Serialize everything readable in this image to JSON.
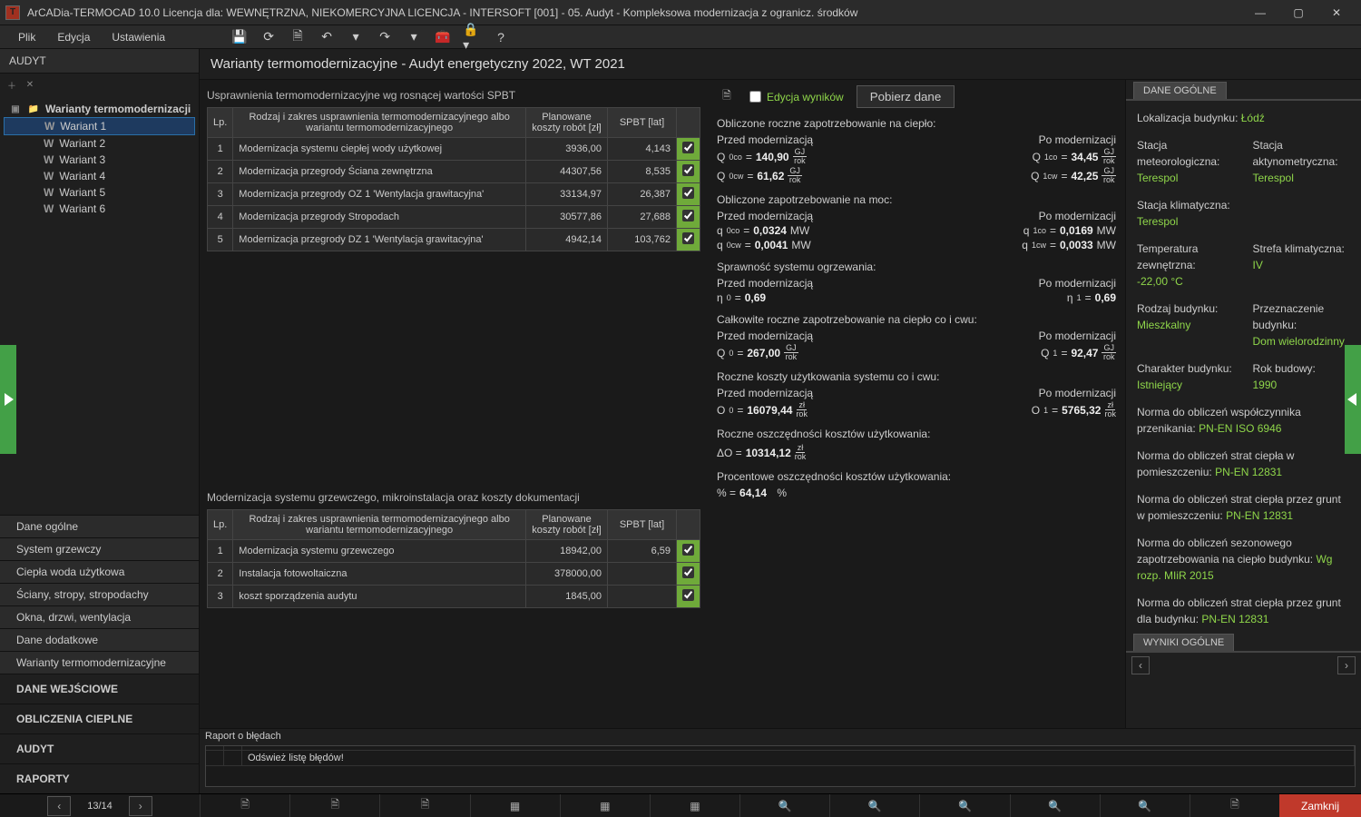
{
  "title": "ArCADia-TERMOCAD 10.0 Licencja dla: WEWNĘTRZNA, NIEKOMERCYJNA LICENCJA - INTERSOFT [001] - 05. Audyt - Kompleksowa modernizacja z ogranicz. środków",
  "menu": {
    "file": "Plik",
    "edit": "Edycja",
    "settings": "Ustawienia"
  },
  "audit_header": "AUDYT",
  "tree_root": "Warianty termomodernizacji",
  "tree_items": [
    "Wariant 1",
    "Wariant 2",
    "Wariant 3",
    "Wariant 4",
    "Wariant 5",
    "Wariant 6"
  ],
  "nav_items": [
    "Dane ogólne",
    "System grzewczy",
    "Ciepła woda użytkowa",
    "Ściany, stropy, stropodachy",
    "Okna, drzwi, wentylacja",
    "Dane dodatkowe",
    "Warianty termomodernizacyjne"
  ],
  "nav_sections": [
    "DANE WEJŚCIOWE",
    "OBLICZENIA CIEPLNE",
    "AUDYT",
    "RAPORTY"
  ],
  "page_title": "Warianty termomodernizacyjne - Audyt energetyczny 2022, WT 2021",
  "table1": {
    "caption": "Usprawnienia termomodernizacyjne wg rosnącej wartości SPBT",
    "headers": [
      "Lp.",
      "Rodzaj i zakres usprawnienia termomodernizacyjnego albo wariantu termomodernizacyjnego",
      "Planowane koszty robót [zł]",
      "SPBT [lat]",
      ""
    ],
    "rows": [
      {
        "lp": "1",
        "desc": "Modernizacja systemu ciepłej wody użytkowej",
        "cost": "3936,00",
        "spbt": "4,143",
        "chk": true
      },
      {
        "lp": "2",
        "desc": "Modernizacja przegrody Ściana zewnętrzna",
        "cost": "44307,56",
        "spbt": "8,535",
        "chk": true
      },
      {
        "lp": "3",
        "desc": "Modernizacja przegrody OZ 1 'Wentylacja grawitacyjna'",
        "cost": "33134,97",
        "spbt": "26,387",
        "chk": true
      },
      {
        "lp": "4",
        "desc": "Modernizacja przegrody Stropodach",
        "cost": "30577,86",
        "spbt": "27,688",
        "chk": true
      },
      {
        "lp": "5",
        "desc": "Modernizacja przegrody DZ 1 'Wentylacja grawitacyjna'",
        "cost": "4942,14",
        "spbt": "103,762",
        "chk": true
      }
    ]
  },
  "table2": {
    "caption": "Modernizacja systemu grzewczego, mikroinstalacja oraz koszty dokumentacji",
    "headers": [
      "Lp.",
      "Rodzaj i zakres usprawnienia termomodernizacyjnego albo wariantu termomodernizacyjnego",
      "Planowane koszty robót [zł]",
      "SPBT [lat]",
      ""
    ],
    "rows": [
      {
        "lp": "1",
        "desc": "Modernizacja systemu grzewczego",
        "cost": "18942,00",
        "spbt": "6,59",
        "chk": true
      },
      {
        "lp": "2",
        "desc": "Instalacja fotowoltaiczna",
        "cost": "378000,00",
        "spbt": "",
        "chk": true
      },
      {
        "lp": "3",
        "desc": "koszt sporządzenia audytu",
        "cost": "1845,00",
        "spbt": "",
        "chk": true,
        "green": true
      }
    ]
  },
  "mid": {
    "edit_label": "Edycja wyników",
    "download": "Pobierz dane",
    "b1": "Obliczone roczne zapotrzebowanie na ciepło:",
    "before": "Przed modernizacją",
    "after": "Po modernizacji",
    "q0co": "140,90",
    "q1co": "34,45",
    "qunit_top": "GJ",
    "qunit_bot": "rok",
    "q0cw": "61,62",
    "q1cw": "42,25",
    "b2": "Obliczone zapotrzebowanie na moc:",
    "p_q0co": "0,0324",
    "p_q1co": "0,0169",
    "p_q0cw": "0,0041",
    "p_q1cw": "0,0033",
    "punit": "MW",
    "b3": "Sprawność systemu ogrzewania:",
    "eta0": "0,69",
    "eta1": "0,69",
    "b4": "Całkowite roczne zapotrzebowanie na ciepło co i cwu:",
    "Q0": "267,00",
    "Q1": "92,47",
    "b5": "Roczne koszty użytkowania systemu co i cwu:",
    "O0": "16079,44",
    "O1": "5765,32",
    "ounit_top": "zł",
    "ounit_bot": "rok",
    "b6": "Roczne oszczędności kosztów użytkowania:",
    "dO": "10314,12",
    "b7": "Procentowe oszczędności kosztów użytkowania:",
    "pct": "64,14",
    "pct_unit": "%"
  },
  "right": {
    "tab": "DANE OGÓLNE",
    "tab2": "WYNIKI OGÓLNE",
    "loc_l": "Lokalizacja budynku:",
    "loc_v": "Łódź",
    "st_met_l": "Stacja meteorologiczna:",
    "st_met_v": "Terespol",
    "st_akt_l": "Stacja aktynometryczna:",
    "st_akt_v": "Terespol",
    "st_klim_l": "Stacja klimatyczna:",
    "st_klim_v": "Terespol",
    "temp_l": "Temperatura zewnętrzna:",
    "temp_v": "-22,00 °C",
    "strefa_l": "Strefa klimatyczna:",
    "strefa_v": "IV",
    "rodz_l": "Rodzaj budynku:",
    "rodz_v": "Mieszkalny",
    "przez_l": "Przeznaczenie budynku:",
    "przez_v": "Dom wielorodzinny",
    "char_l": "Charakter budynku:",
    "char_v": "Istniejący",
    "rok_l": "Rok budowy:",
    "rok_v": "1990",
    "n1_l": "Norma do obliczeń współczynnika przenikania:",
    "n1_v": "PN-EN ISO 6946",
    "n2_l": "Norma do obliczeń strat ciepła w pomieszczeniu:",
    "n2_v": "PN-EN 12831",
    "n3_l": "Norma do obliczeń strat ciepła przez grunt w pomieszczeniu:",
    "n3_v": "PN-EN 12831",
    "n4_l": "Norma do obliczeń sezonowego zapotrzebowania na ciepło budynku:",
    "n4_v": "Wg rozp. MIiR 2015",
    "n5_l": "Norma do obliczeń strat ciepła przez grunt dla budynku:",
    "n5_v": "PN-EN 12831"
  },
  "errors": {
    "title": "Raport o błędach",
    "refresh": "Odśwież listę błędów!"
  },
  "pager": "13/14",
  "close": "Zamknij"
}
